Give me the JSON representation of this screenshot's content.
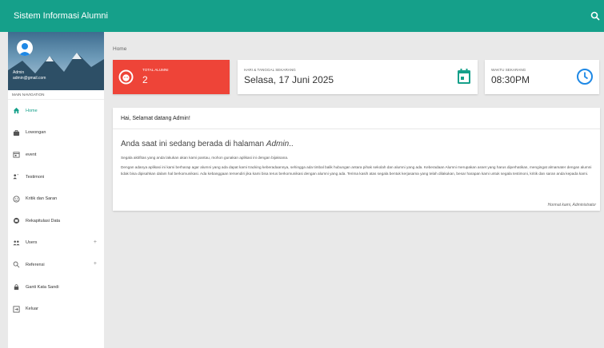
{
  "header": {
    "title": "Sistem Informasi Alumni"
  },
  "sidebar": {
    "user_name": "Admin",
    "user_email": "admin@gmail.com",
    "nav_header": "MAIN NAVIGATION",
    "items": [
      {
        "label": "Home",
        "icon": "home-icon",
        "active": true
      },
      {
        "label": "Lowongan",
        "icon": "briefcase-icon"
      },
      {
        "label": "event",
        "icon": "calendar-icon"
      },
      {
        "label": "Testimoni",
        "icon": "testimonial-icon"
      },
      {
        "label": "Kritik dan Saran",
        "icon": "smile-icon"
      },
      {
        "label": "Rekapitulasi Data",
        "icon": "database-icon"
      },
      {
        "label": "Users",
        "icon": "users-icon",
        "expand": "+"
      },
      {
        "label": "Referensi",
        "icon": "search-icon",
        "expand": "+"
      },
      {
        "label": "Ganti Kata Sandi",
        "icon": "lock-icon"
      },
      {
        "label": "Keluar",
        "icon": "logout-icon"
      }
    ]
  },
  "breadcrumb": "Home",
  "stats": {
    "alumni_label": "TOTAL ALUMNI",
    "alumni_value": "2",
    "date_label": "HARI & TANGGAL SEKARANG",
    "date_value": "Selasa, 17 Juni 2025",
    "time_label": "WAKTU SEKARANG",
    "time_value": "08:30PM"
  },
  "welcome": {
    "greeting": "Hai, Selamat datang Admin!",
    "lead_text": "Anda saat ini sedang berada di halaman ",
    "lead_emph": "Admin",
    "lead_end": "..",
    "p1": "Segala aktifitas yang anda lakukan akan kami pantau, mohon gunakan aplikasi ini dengan bijaksana.",
    "p2": "Dengan adanya aplikasi ini kami berharap agar alumni yang ada dapat kami tracking keberadaannya, sehingga ada timbal balik hubungan antara pihak sekolah dan alumni yang ada. Keberadaan Alumni merupakan asset yang harus diperhatikan, mengingat almamater dengan alumni tidak bisa dipisahkan dalam hal berkomunikasi. Ada kebanggaan tersendiri jika kami bisa terus berkomunikasi dengan alumni yang ada. Terima kasih atas segala bentuk kerjasama yang telah dilakukan, besar harapan kami untuk segala testimoni, kritik dan saran anda kepada kami.",
    "sign": "Hormat kami, Administrator"
  },
  "colors": {
    "primary": "#15a08a",
    "danger": "#ee4438"
  }
}
